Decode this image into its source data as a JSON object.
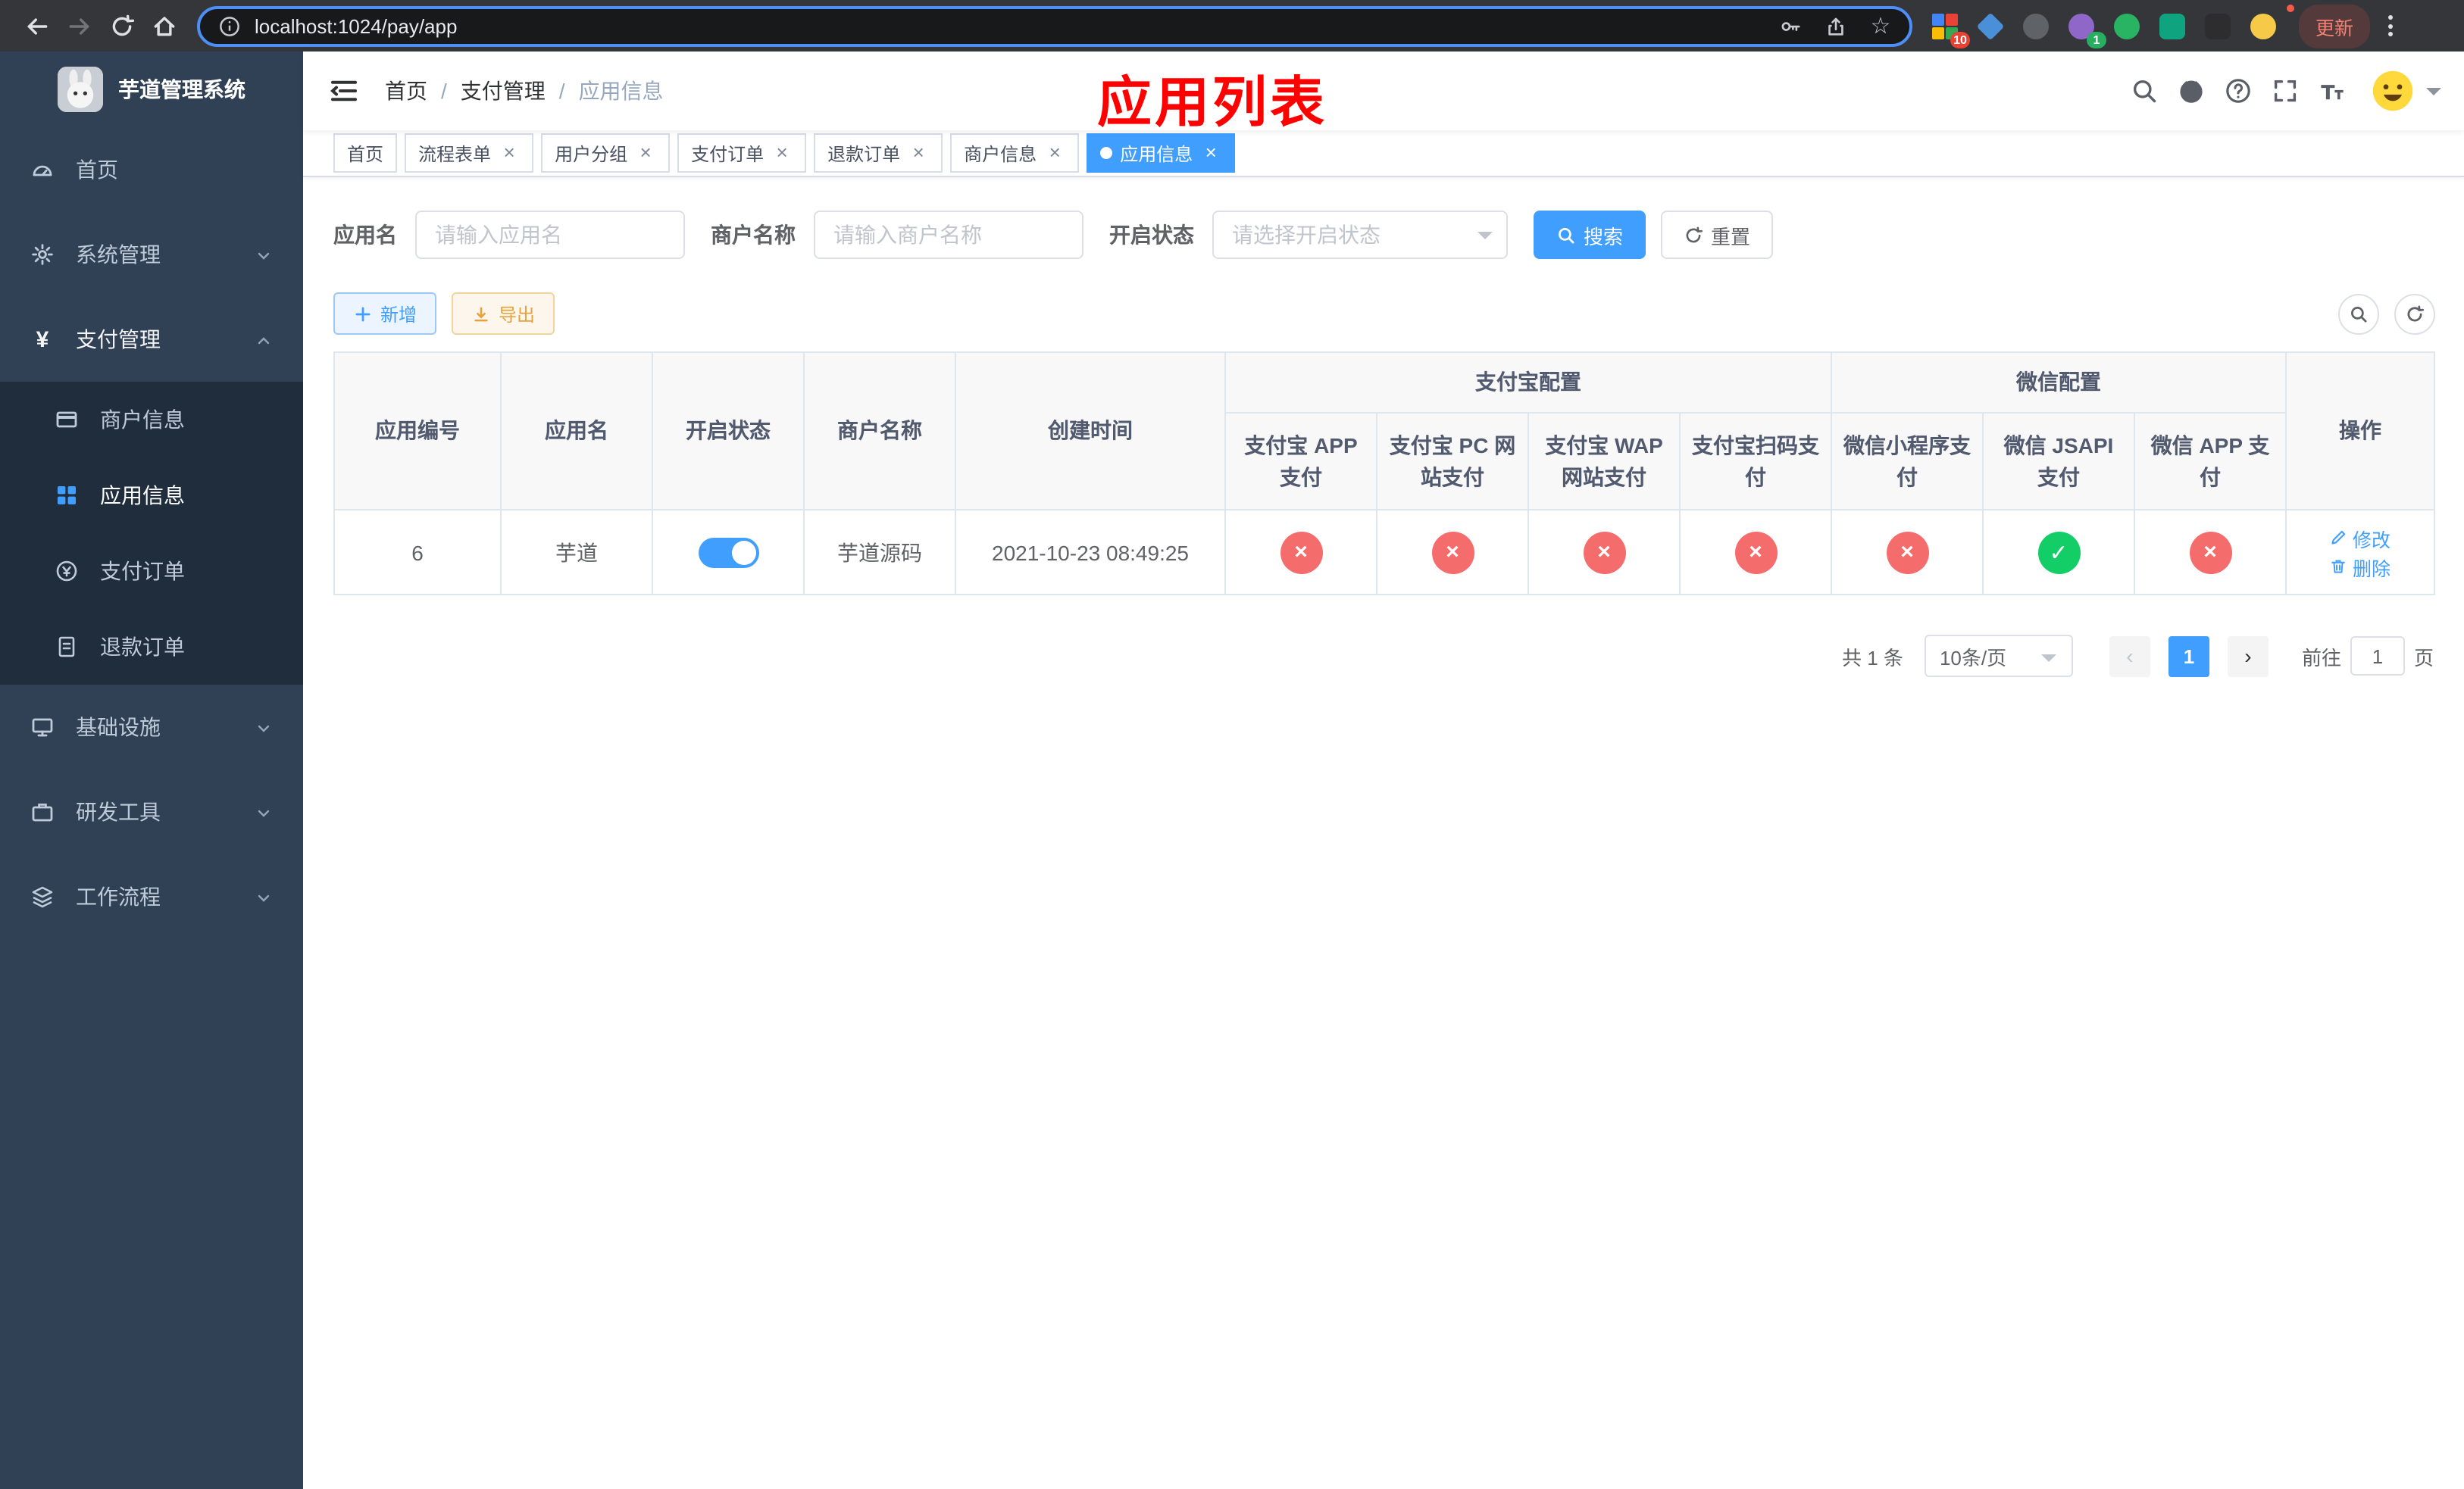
{
  "browser": {
    "url": "localhost:1024/pay/app",
    "update_label": "更新",
    "ext_badge_1": "10",
    "ext_badge_2": "1"
  },
  "sidebar": {
    "title": "芋道管理系统",
    "items": [
      {
        "label": "首页"
      },
      {
        "label": "系统管理"
      },
      {
        "label": "支付管理"
      },
      {
        "label": "基础设施"
      },
      {
        "label": "研发工具"
      },
      {
        "label": "工作流程"
      }
    ],
    "submenu": [
      {
        "label": "商户信息"
      },
      {
        "label": "应用信息"
      },
      {
        "label": "支付订单"
      },
      {
        "label": "退款订单"
      }
    ]
  },
  "header": {
    "breadcrumb": [
      {
        "label": "首页"
      },
      {
        "label": "支付管理"
      },
      {
        "label": "应用信息"
      }
    ],
    "separator": "/",
    "annotation": "应用列表"
  },
  "tabs": [
    {
      "label": "首页"
    },
    {
      "label": "流程表单"
    },
    {
      "label": "用户分组"
    },
    {
      "label": "支付订单"
    },
    {
      "label": "退款订单"
    },
    {
      "label": "商户信息"
    },
    {
      "label": "应用信息"
    }
  ],
  "filters": {
    "app_name_label": "应用名",
    "app_name_placeholder": "请输入应用名",
    "merchant_label": "商户名称",
    "merchant_placeholder": "请输入商户名称",
    "status_label": "开启状态",
    "status_placeholder": "请选择开启状态",
    "search_label": "搜索",
    "reset_label": "重置"
  },
  "toolbar": {
    "add_label": "新增",
    "export_label": "导出"
  },
  "table": {
    "columns": {
      "id": "应用编号",
      "name": "应用名",
      "status": "开启状态",
      "merchant": "商户名称",
      "created": "创建时间",
      "alipay_group": "支付宝配置",
      "wechat_group": "微信配置",
      "alipay_app": "支付宝 APP 支付",
      "alipay_pc": "支付宝 PC 网站支付",
      "alipay_wap": "支付宝 WAP 网站支付",
      "alipay_qr": "支付宝扫码支付",
      "wx_mini": "微信小程序支付",
      "wx_jsapi": "微信 JSAPI 支付",
      "wx_app": "微信 APP 支付",
      "actions": "操作"
    },
    "rows": [
      {
        "id": "6",
        "name": "芋道",
        "enabled": true,
        "merchant": "芋道源码",
        "created": "2021-10-23 08:49:25",
        "alipay_app": false,
        "alipay_pc": false,
        "alipay_wap": false,
        "alipay_qr": false,
        "wx_mini": false,
        "wx_jsapi": true,
        "wx_app": false,
        "edit_label": "修改",
        "delete_label": "删除"
      }
    ]
  },
  "pagination": {
    "total": "共 1 条",
    "page_size": "10条/页",
    "page": "1",
    "goto_label": "前往",
    "goto_value": "1",
    "page_unit": "页"
  },
  "icons": {
    "fail": "×",
    "success": "✓"
  },
  "colors": {
    "primary": "#409eff",
    "success": "#13ce66",
    "danger": "#f56c6c",
    "warning": "#e6a23c",
    "sidebar_bg": "#304156",
    "submenu_bg": "#1f2d3d",
    "annotation": "#ff0000"
  }
}
